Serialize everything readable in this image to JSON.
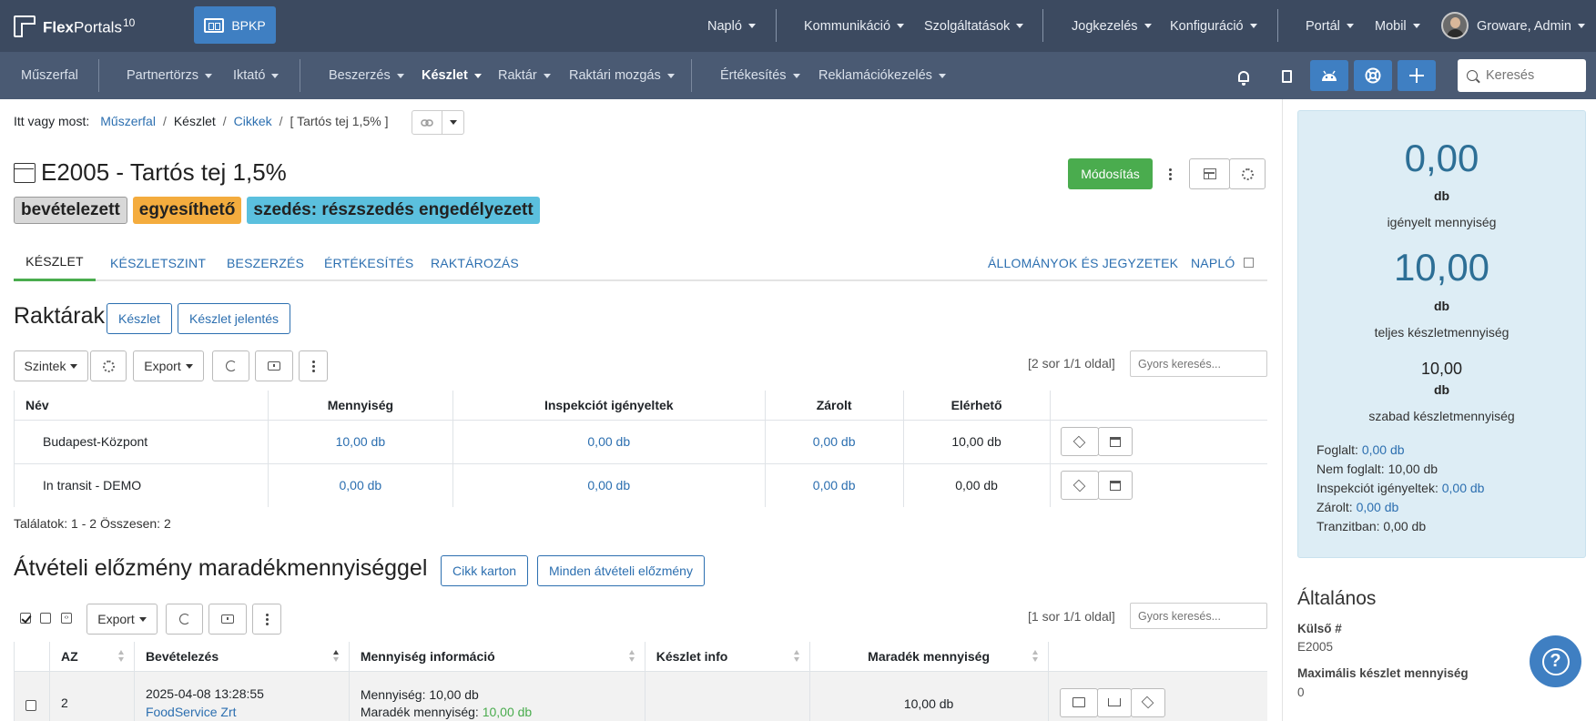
{
  "app": {
    "logo_bold": "Flex",
    "logo_light": "Portals",
    "logo_version": "10",
    "workspace_button": "BPKP"
  },
  "topnav": [
    "Napló",
    "Kommunikáció",
    "Szolgáltatások",
    "Jogkezelés",
    "Konfiguráció",
    "Portál",
    "Mobil"
  ],
  "user_name": "Groware, Admin",
  "subnav": {
    "dashboard": "Műszerfal",
    "items": [
      "Partnertörzs",
      "Iktató",
      "Beszerzés",
      "Készlet",
      "Raktár",
      "Raktári mozgás",
      "Értékesítés",
      "Reklamációkezelés"
    ],
    "active": "Készlet"
  },
  "search": {
    "placeholder": "Keresés"
  },
  "breadcrumb": {
    "prefix": "Itt vagy most:",
    "items": [
      "Műszerfal",
      "Készlet",
      "Cikkek",
      "[ Tartós tej 1,5% ]"
    ]
  },
  "page": {
    "title": "E2005 - Tartós tej 1,5%",
    "badges": [
      "bevételezett",
      "egyesíthető",
      "szedés: részszedés engedélyezett"
    ],
    "edit_button": "Módosítás"
  },
  "tabs": {
    "left": [
      "KÉSZLET",
      "KÉSZLETSZINT",
      "BESZERZÉS",
      "ÉRTÉKESÍTÉS",
      "RAKTÁROZÁS"
    ],
    "right": [
      "ÁLLOMÁNYOK ÉS JEGYZETEK",
      "NAPLÓ"
    ]
  },
  "warehouses": {
    "heading": "Raktárak",
    "buttons": [
      "Készlet",
      "Készlet jelentés"
    ],
    "toolbar": {
      "levels": "Szintek",
      "export": "Export"
    },
    "count": "[2 sor 1/1 oldal]",
    "quick_search_placeholder": "Gyors keresés...",
    "columns": [
      "Név",
      "Mennyiség",
      "Inspekciót igényeltek",
      "Zárolt",
      "Elérhető"
    ],
    "rows": [
      {
        "name": "Budapest-Központ",
        "qty": "10,00 db",
        "inspection": "0,00 db",
        "locked": "0,00 db",
        "available": "10,00 db"
      },
      {
        "name": "In transit - DEMO",
        "qty": "0,00 db",
        "inspection": "0,00 db",
        "locked": "0,00 db",
        "available": "0,00 db"
      }
    ],
    "footer": "Találatok: 1 - 2 Összesen: 2"
  },
  "history": {
    "heading": "Átvételi előzmény maradékmennyiséggel",
    "buttons": [
      "Cikk karton",
      "Minden átvételi előzmény"
    ],
    "toolbar": {
      "export": "Export"
    },
    "count": "[1 sor 1/1 oldal]",
    "quick_search_placeholder": "Gyors keresés...",
    "columns": [
      "AZ",
      "Bevételezés",
      "Mennyiség információ",
      "Készlet info",
      "Maradék mennyiség"
    ],
    "rows": [
      {
        "id": "2",
        "date": "2025-04-08 13:28:55",
        "partner": "FoodService Zrt",
        "qty_label": "Mennyiség: 10,00 db",
        "remaining_label": "Maradék mennyiség:",
        "remaining_value": "10,00 db",
        "remaining": "10,00 db"
      }
    ]
  },
  "stock_panel": {
    "required_value": "0,00",
    "required_unit": "db",
    "required_label": "igényelt mennyiség",
    "total_value": "10,00",
    "total_unit": "db",
    "total_label": "teljes készletmennyiség",
    "free_value": "10,00",
    "free_unit": "db",
    "free_label": "szabad készletmennyiség",
    "stats": [
      {
        "label": "Foglalt:",
        "value": "0,00 db",
        "link": true
      },
      {
        "label": "Nem foglalt:",
        "value": "10,00 db",
        "link": false
      },
      {
        "label": "Inspekciót igényeltek:",
        "value": "0,00 db",
        "link": true
      },
      {
        "label": "Zárolt:",
        "value": "0,00 db",
        "link": true
      },
      {
        "label": "Tranzitban:",
        "value": "0,00 db",
        "link": false
      }
    ]
  },
  "general": {
    "heading": "Általános",
    "fields": [
      {
        "label": "Külső #",
        "value": "E2005"
      },
      {
        "label": "Maximális készlet mennyiség",
        "value": "0"
      }
    ]
  },
  "colors": {
    "topbar": "#3c4a60",
    "subbar": "#4a5a73",
    "primary": "#3f7fc2",
    "success": "#4aac4e",
    "warning": "#f4ac3e",
    "info": "#5bc0de",
    "panel": "#ddedf5"
  },
  "icons": [
    "bell-icon",
    "document-icon",
    "android-icon",
    "support-icon",
    "plus-icon",
    "search-icon",
    "help-icon"
  ]
}
